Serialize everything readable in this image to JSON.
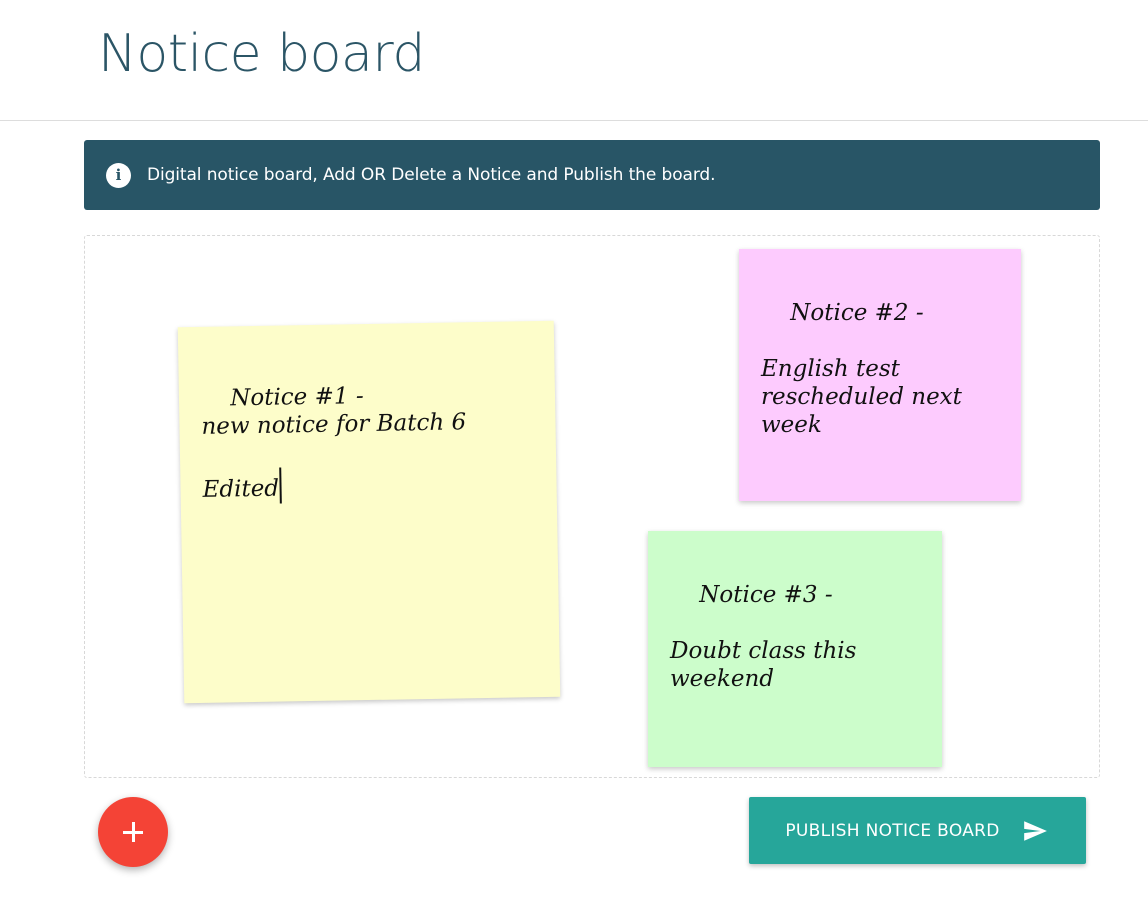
{
  "header": {
    "title": "Notice board"
  },
  "banner": {
    "icon": "info-icon",
    "icon_glyph": "i",
    "text": "Digital notice board, Add OR Delete a Notice and Publish the board."
  },
  "notes": [
    {
      "id": "notice-1",
      "color": "#fdfdca",
      "text": "Notice #1 -\nnew notice for Batch 6\n\nEdited",
      "state": "editing"
    },
    {
      "id": "notice-2",
      "color": "#fdcbfe",
      "text": "Notice #2 -\n\nEnglish test\nrescheduled next\nweek"
    },
    {
      "id": "notice-3",
      "color": "#ccfdcb",
      "text": "Notice #3 -\n\nDoubt class this\nweekend"
    }
  ],
  "actions": {
    "add_icon": "plus-icon",
    "add_color": "#f44336",
    "publish_label": "PUBLISH NOTICE BOARD",
    "publish_icon": "send-icon",
    "publish_color": "#26a69a"
  },
  "colors": {
    "title": "#2b5566",
    "banner_bg": "#285566"
  }
}
